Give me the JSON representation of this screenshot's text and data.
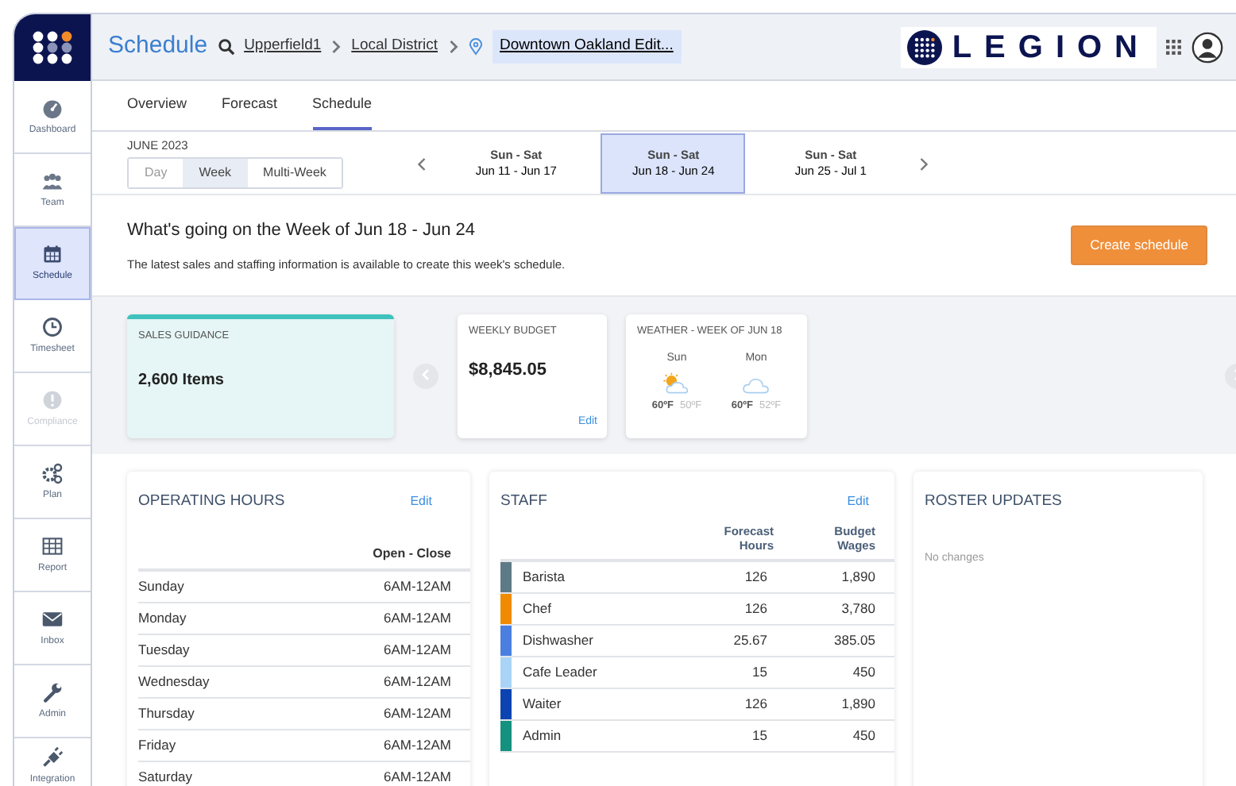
{
  "sidebar": {
    "items": [
      {
        "label": "Dashboard",
        "kind": "gauge",
        "selected": false,
        "disabled": false
      },
      {
        "label": "Team",
        "kind": "team",
        "selected": false,
        "disabled": false
      },
      {
        "label": "Schedule",
        "kind": "calendar",
        "selected": true,
        "disabled": false
      },
      {
        "label": "Timesheet",
        "kind": "clock",
        "selected": false,
        "disabled": false
      },
      {
        "label": "Compliance",
        "kind": "alert",
        "selected": false,
        "disabled": true
      },
      {
        "label": "Plan",
        "kind": "gears",
        "selected": false,
        "disabled": false
      },
      {
        "label": "Report",
        "kind": "grid",
        "selected": false,
        "disabled": false
      },
      {
        "label": "Inbox",
        "kind": "mail",
        "selected": false,
        "disabled": false
      },
      {
        "label": "Admin",
        "kind": "wrench",
        "selected": false,
        "disabled": false
      },
      {
        "label": "Integration",
        "kind": "plug",
        "selected": false,
        "disabled": false
      }
    ]
  },
  "header": {
    "title": "Schedule",
    "breadcrumbs": [
      {
        "label": "Upperfield1"
      },
      {
        "label": "Local District"
      }
    ],
    "location": "Downtown Oakland Edit...",
    "brand": "LEGION"
  },
  "tabs": [
    {
      "label": "Overview",
      "selected": false
    },
    {
      "label": "Forecast",
      "selected": false
    },
    {
      "label": "Schedule",
      "selected": true
    }
  ],
  "week_nav": {
    "month": "JUNE 2023",
    "view_modes": [
      {
        "label": "Day",
        "selected": false
      },
      {
        "label": "Week",
        "selected": true
      },
      {
        "label": "Multi-Week",
        "selected": false
      }
    ],
    "weeks": [
      {
        "days": "Sun - Sat",
        "range": "Jun 11 - Jun 17",
        "selected": false
      },
      {
        "days": "Sun - Sat",
        "range": "Jun 18 - Jun 24",
        "selected": true
      },
      {
        "days": "Sun - Sat",
        "range": "Jun 25 - Jul 1",
        "selected": false
      }
    ]
  },
  "summary": {
    "heading": "What's going on the Week of Jun 18 - Jun 24",
    "description": "The latest sales and staffing information is available to create this week's schedule.",
    "button": "Create schedule"
  },
  "cards": {
    "sales_guidance": {
      "title": "SALES GUIDANCE",
      "value": "2,600 Items"
    },
    "weekly_budget": {
      "title": "WEEKLY BUDGET",
      "value": "$8,845.05",
      "link": "Edit"
    },
    "weather": {
      "title": "WEATHER - WEEK OF JUN 18",
      "days": [
        {
          "day": "Sun",
          "kind": "partly_sunny",
          "high": "60ºF",
          "low": "50ºF"
        },
        {
          "day": "Mon",
          "kind": "cloudy",
          "high": "60ºF",
          "low": "52ºF"
        }
      ]
    }
  },
  "operating_hours": {
    "title": "OPERATING HOURS",
    "link": "Edit",
    "column": "Open - Close",
    "rows": [
      {
        "day": "Sunday",
        "hours": "6AM-12AM"
      },
      {
        "day": "Monday",
        "hours": "6AM-12AM"
      },
      {
        "day": "Tuesday",
        "hours": "6AM-12AM"
      },
      {
        "day": "Wednesday",
        "hours": "6AM-12AM"
      },
      {
        "day": "Thursday",
        "hours": "6AM-12AM"
      },
      {
        "day": "Friday",
        "hours": "6AM-12AM"
      },
      {
        "day": "Saturday",
        "hours": "6AM-12AM"
      }
    ]
  },
  "staff": {
    "title": "STAFF",
    "link": "Edit",
    "columns": [
      "Forecast Hours",
      "Budget Wages"
    ],
    "rows": [
      {
        "role": "Barista",
        "color": "#5f7a87",
        "hours": "126",
        "wages": "1,890"
      },
      {
        "role": "Chef",
        "color": "#f08a00",
        "hours": "126",
        "wages": "3,780"
      },
      {
        "role": "Dishwasher",
        "color": "#4a7fe0",
        "hours": "25.67",
        "wages": "385.05"
      },
      {
        "role": "Cafe Leader",
        "color": "#a9d4f7",
        "hours": "15",
        "wages": "450"
      },
      {
        "role": "Waiter",
        "color": "#0b44b0",
        "hours": "126",
        "wages": "1,890"
      },
      {
        "role": "Admin",
        "color": "#15917f",
        "hours": "15",
        "wages": "450"
      }
    ]
  },
  "roster_updates": {
    "title": "ROSTER UPDATES",
    "message": "No changes"
  }
}
